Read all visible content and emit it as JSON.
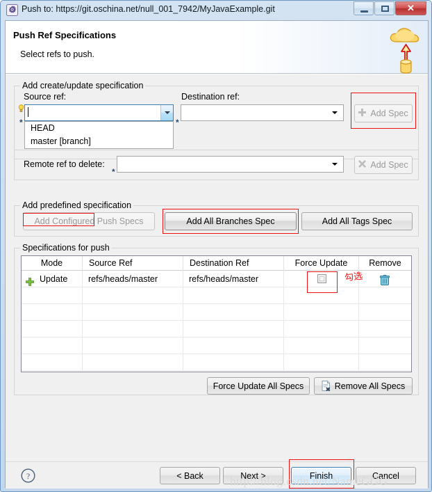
{
  "window": {
    "title": "Push to: https://git.oschina.net/null_001_7942/MyJavaExample.git",
    "icon": "gear-icon",
    "minimize_label": "",
    "maximize_label": "",
    "close_label": "✕"
  },
  "header": {
    "title": "Push Ref Specifications",
    "description": "Select refs to push.",
    "icon": "push-to-cloud-icon"
  },
  "create_update_group": {
    "label": "Add create/update specification",
    "source_ref_label": "Source ref:",
    "source_ref_value": "",
    "destination_ref_label": "Destination ref:",
    "destination_ref_value": "",
    "add_spec_label": "Add Spec",
    "add_spec_icon": "plus-icon",
    "add_spec_enabled": false,
    "dropdown_items": [
      "HEAD",
      "master [branch]"
    ],
    "decorator_required": "*",
    "decorator_hint": "lightbulb-icon"
  },
  "delete_group": {
    "remote_ref_label": "Remote ref to delete:",
    "remote_ref_value": "",
    "add_spec_label": "Add Spec",
    "add_spec_icon": "cross-icon",
    "add_spec_enabled": false,
    "decorator_required": "*"
  },
  "predefined_group": {
    "label": "Add predefined specification",
    "buttons": [
      {
        "label": "Add Configured Push Specs",
        "enabled": false
      },
      {
        "label": "Add All Branches Spec",
        "enabled": true
      },
      {
        "label": "Add All Tags Spec",
        "enabled": true
      }
    ]
  },
  "specifications_group": {
    "label": "Specifications for push",
    "columns": [
      "Mode",
      "Source Ref",
      "Destination Ref",
      "Force Update",
      "Remove"
    ],
    "rows": [
      {
        "mode_icon": "green-plus-icon",
        "mode": "Update",
        "source_ref": "refs/heads/master",
        "destination_ref": "refs/heads/master",
        "force_update": false,
        "remove_icon": "trash-icon"
      }
    ],
    "empty_row_count": 6,
    "footer_buttons": [
      {
        "label": "Force Update All Specs",
        "icon": ""
      },
      {
        "label": "Remove All Specs",
        "icon": "remove-doc-icon"
      }
    ]
  },
  "annotations": {
    "check_hint": "勾选",
    "highlight_color": "#ee1111"
  },
  "footer": {
    "help_icon": "help-question-icon",
    "buttons": [
      {
        "label": "< Back",
        "enabled": true,
        "default": false
      },
      {
        "label": "Next >",
        "enabled": true,
        "default": false
      },
      {
        "label": "Finish",
        "enabled": true,
        "default": true
      },
      {
        "label": "Cancel",
        "enabled": true,
        "default": false
      }
    ]
  },
  "watermark": "http://blog.csdn.net/NameGGG"
}
